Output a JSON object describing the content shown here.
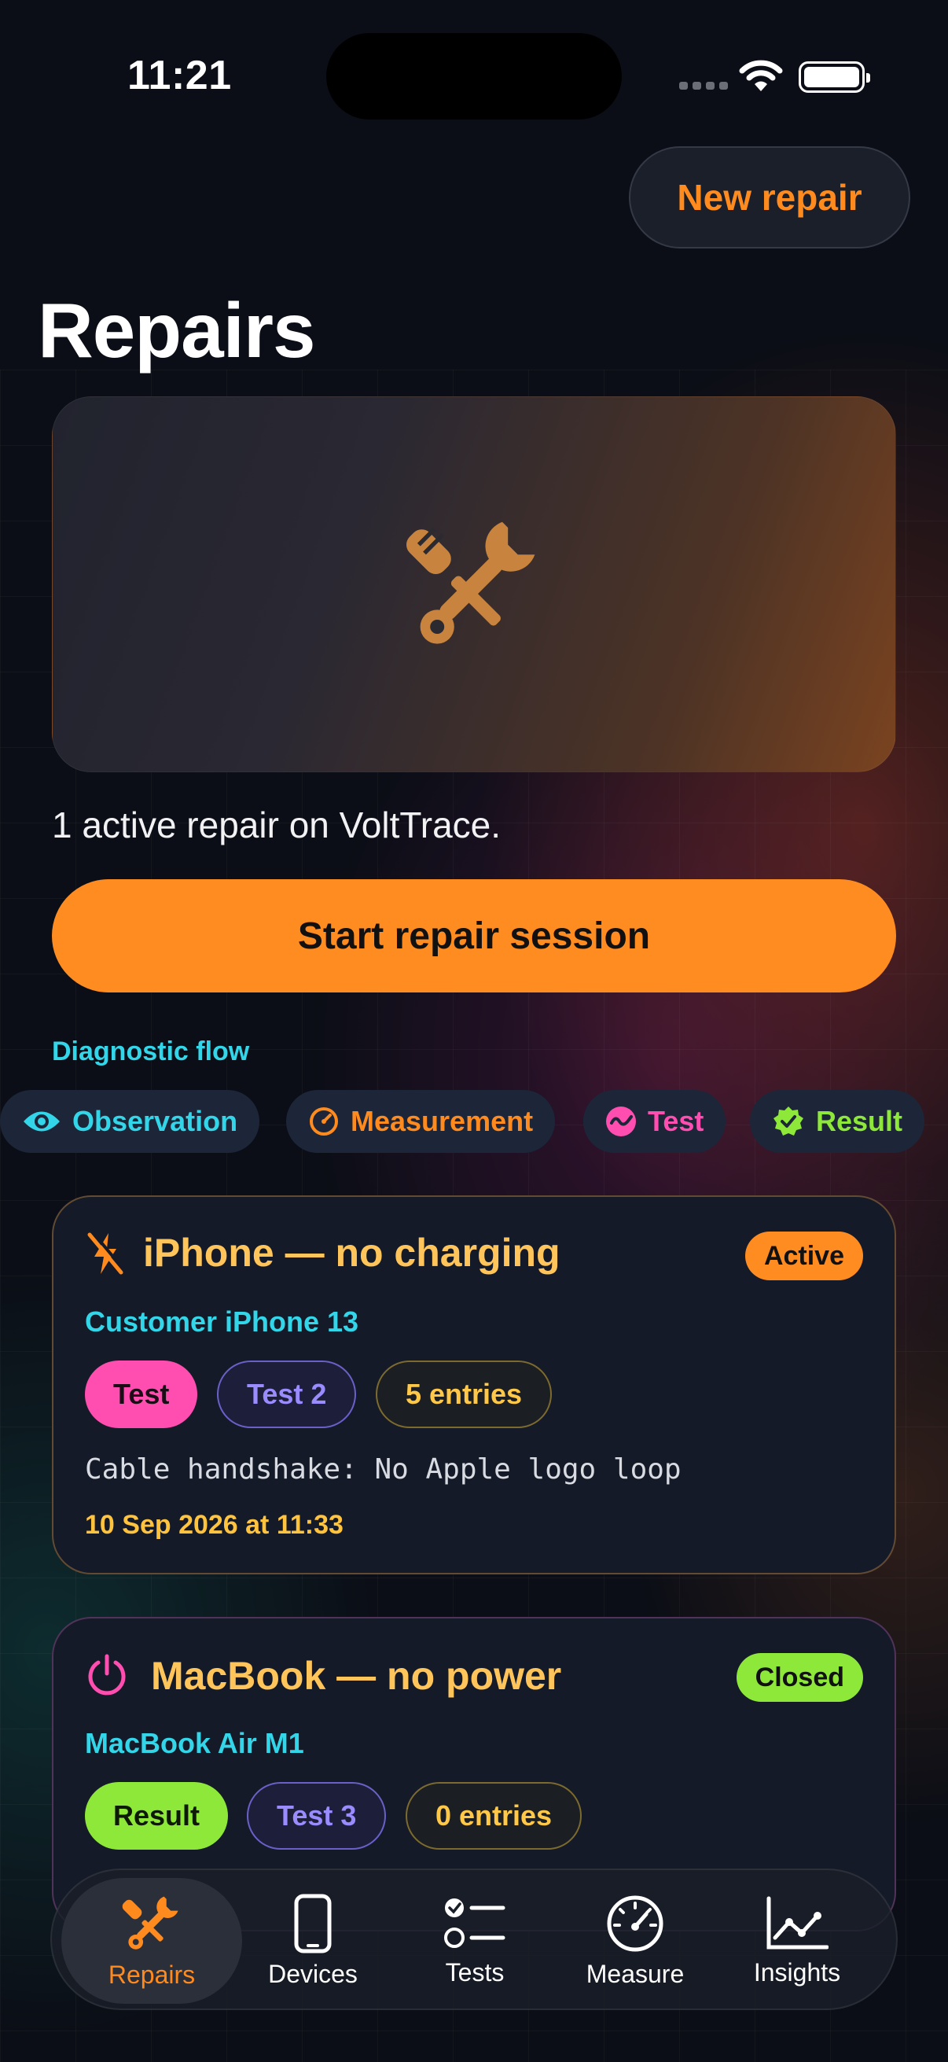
{
  "status_bar": {
    "time": "11:21"
  },
  "header": {
    "new_repair_label": "New repair",
    "title": "Repairs"
  },
  "summary": {
    "text": "1 active repair on VoltTrace.",
    "start_button_label": "Start repair session"
  },
  "flow": {
    "label": "Diagnostic flow",
    "chips": [
      {
        "label": "Observation",
        "icon": "eye-icon",
        "color": "#33d5e8"
      },
      {
        "label": "Measurement",
        "icon": "gauge-icon",
        "color": "#ff8a1e"
      },
      {
        "label": "Test",
        "icon": "waveform-icon",
        "color": "#ff4db0"
      },
      {
        "label": "Result",
        "icon": "checkmark-seal-icon",
        "color": "#8ee83a"
      }
    ]
  },
  "repairs": [
    {
      "title": "iPhone — no charging",
      "icon": "bolt-slash-icon",
      "device": "Customer iPhone 13",
      "status": "Active",
      "status_color": "#ff8c21",
      "tags": [
        "Test",
        "Test 2",
        "5 entries"
      ],
      "note": "Cable handshake: No Apple logo loop",
      "date": "10 Sep 2026 at 11:33"
    },
    {
      "title": "MacBook — no power",
      "icon": "power-icon",
      "device": "MacBook Air M1",
      "status": "Closed",
      "status_color": "#8ee83a",
      "tags": [
        "Result",
        "Test 3",
        "0 entries"
      ]
    }
  ],
  "tab_bar": {
    "tabs": [
      {
        "label": "Repairs",
        "icon": "wrench-screwdriver-icon",
        "active": true
      },
      {
        "label": "Devices",
        "icon": "iphone-icon",
        "active": false
      },
      {
        "label": "Tests",
        "icon": "checklist-icon",
        "active": false
      },
      {
        "label": "Measure",
        "icon": "speedometer-icon",
        "active": false
      },
      {
        "label": "Insights",
        "icon": "line-chart-icon",
        "active": false
      }
    ]
  },
  "colors": {
    "accent": "#ff8c21",
    "cyan": "#33d5e8",
    "background": "#0b0e16"
  }
}
